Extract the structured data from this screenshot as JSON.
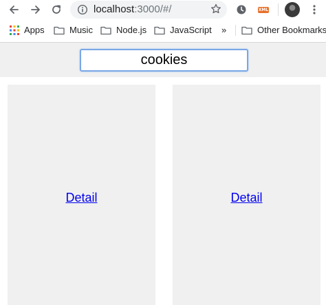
{
  "browser": {
    "url_host": "localhost",
    "url_rest": ":3000/#/",
    "extension_badge": "XML"
  },
  "bookmarks": {
    "apps": "Apps",
    "items": [
      "Music",
      "Node.js",
      "JavaScript"
    ],
    "overflow": "»",
    "other": "Other Bookmarks"
  },
  "page": {
    "search": {
      "value": "cookies"
    },
    "cards": [
      {
        "link": "Detail"
      },
      {
        "link": "Detail"
      }
    ]
  },
  "colors": {
    "accent": "#7aa7e6",
    "link": "#0000ee",
    "panel": "#f0f0f0"
  }
}
